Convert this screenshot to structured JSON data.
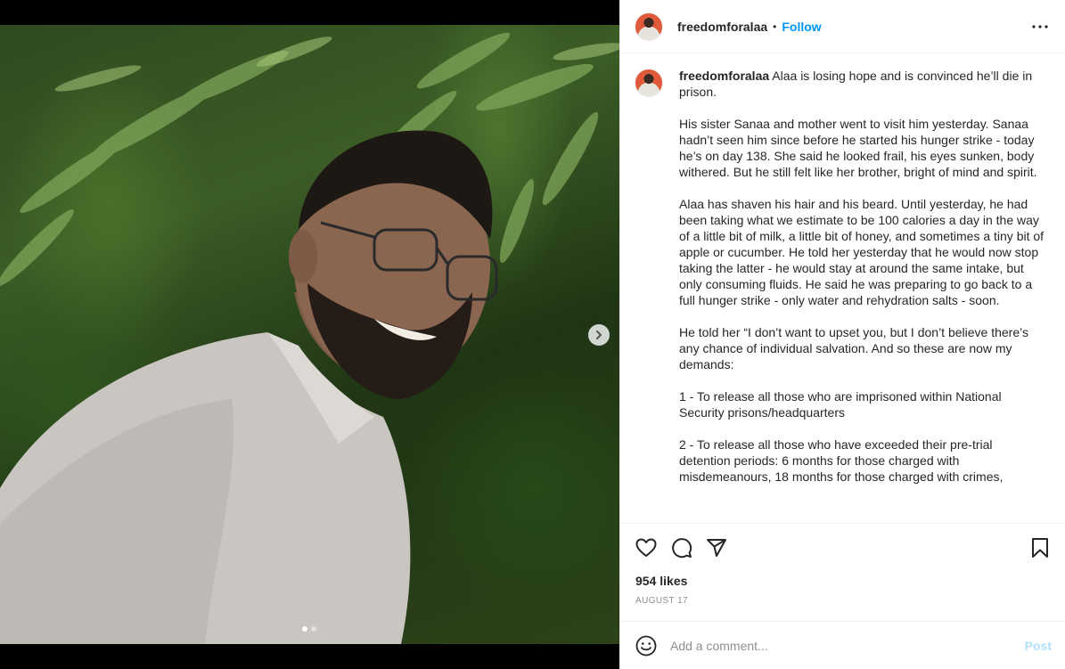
{
  "post": {
    "username": "freedomforalaa",
    "separator": "•",
    "follow_label": "Follow",
    "caption_username": "freedomforalaa",
    "caption_paragraphs": [
      "Alaa is losing hope and is convinced he’ll die in prison.",
      "His sister Sanaa and mother went to visit him yesterday. Sanaa hadn’t seen him since before he started his hunger strike - today he’s on day 138. She said he looked frail, his eyes sunken, body withered. But he still felt like her brother, bright of mind and spirit.",
      "Alaa has shaven his hair and his beard. Until yesterday, he had been taking what we estimate to be 100 calories a day in the way of a little bit of milk, a little bit of honey, and sometimes a tiny bit of apple or cucumber. He told her yesterday that he would now stop taking the latter - he would stay at around the same intake, but only consuming fluids. He said he was preparing to go back to a full hunger strike - only water and rehydration salts - soon.",
      "He told her “I don’t want to upset you, but I don’t believe there’s any chance of individual salvation. And so these are now my demands:",
      "1 - To release all those who are imprisoned within National Security prisons/headquarters",
      "2 - To release all those who have exceeded their pre-trial detention periods: 6 months for those charged with misdemeanours, 18 months for those charged with crimes,"
    ],
    "likes": "954 likes",
    "date": "AUGUST 17",
    "carousel": {
      "total": 2,
      "current": 1
    }
  },
  "comment": {
    "placeholder": "Add a comment...",
    "post_label": "Post"
  },
  "icons": {
    "more": "more-options-icon",
    "like": "heart-icon",
    "comment": "comment-icon",
    "share": "share-icon",
    "save": "bookmark-icon",
    "emoji": "emoji-icon",
    "next": "chevron-right-icon"
  },
  "colors": {
    "follow": "#0095f6",
    "post_disabled": "#b2dffc",
    "muted": "#8e8e8e",
    "text": "#262626"
  }
}
